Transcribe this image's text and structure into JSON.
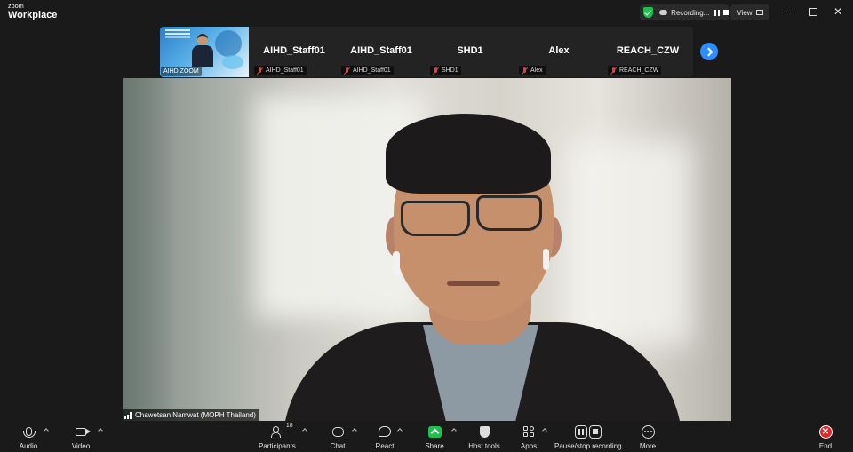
{
  "app": {
    "logo_small": "zoom",
    "logo_big": "Workplace"
  },
  "titlebar": {
    "recording_label": "Recording...",
    "view_label": "View",
    "colors": {
      "shield": "#1fbf4f"
    }
  },
  "thumbnails": [
    {
      "name": "",
      "label": "AIHD ZOOM"
    },
    {
      "name": "AIHD_Staff01",
      "label": "AIHD_Staff01"
    },
    {
      "name": "AIHD_Staff01",
      "label": "AIHD_Staff01"
    },
    {
      "name": "SHD1",
      "label": "SHD1"
    },
    {
      "name": "Alex",
      "label": "Alex"
    },
    {
      "name": "REACH_CZW",
      "label": "REACH_CZW"
    }
  ],
  "main_video": {
    "name_tag": "Chawetsan Namwat (MOPH Thailand)"
  },
  "toolbar": {
    "audio": "Audio",
    "video": "Video",
    "participants": "Participants",
    "participants_count": "18",
    "chat": "Chat",
    "react": "React",
    "share": "Share",
    "host_tools": "Host tools",
    "apps": "Apps",
    "pause_stop_recording": "Pause/stop recording",
    "more": "More",
    "end": "End",
    "colors": {
      "share": "#1fbf4f",
      "end": "#e02828",
      "accent": "#2d8cff"
    }
  },
  "icons": [
    "shield-check-icon",
    "cloud-icon",
    "pause-icon",
    "stop-icon",
    "grid-icon",
    "mic-icon",
    "camera-icon",
    "people-icon",
    "chat-icon",
    "heart-icon",
    "share-arrow-icon",
    "shield-icon",
    "apps-icon",
    "pause-stop-icon",
    "more-dots-icon",
    "end-icon",
    "chevron-right-icon",
    "muted-mic-icon",
    "signal-icon"
  ]
}
